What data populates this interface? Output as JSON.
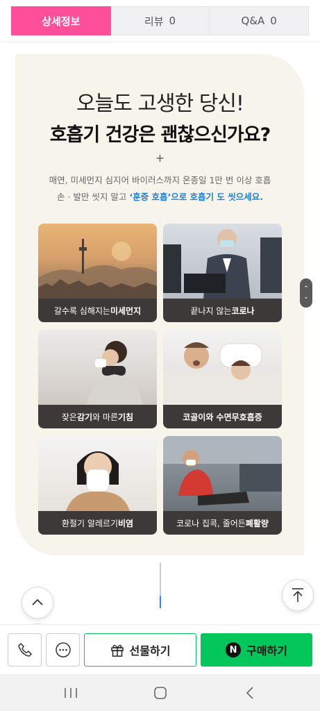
{
  "tabs": [
    {
      "label": "상세정보",
      "count": ""
    },
    {
      "label": "리뷰",
      "count": "0"
    },
    {
      "label": "Q&A",
      "count": "0"
    }
  ],
  "headline": {
    "line1": "오늘도 고생한 당신!",
    "line2": "호흡기 건강은 괜찮으신가요?",
    "plus": "+"
  },
  "description": {
    "line1": "매연, 미세먼지 심지어 바이러스까지 온종일 1만 번 이상 호흡",
    "line2_prefix": "손 · 발만 씻지 말고 ",
    "line2_highlight": "‘훈증 호흡’으로 호흡기 도 씻으세요."
  },
  "tiles": [
    {
      "normal": "갈수록 심해지는 ",
      "bold": "미세먼지",
      "suffix": ""
    },
    {
      "normal": "끝나지 않는 ",
      "bold": "코로나",
      "suffix": ""
    },
    {
      "normal": "잦은 ",
      "bold": "감기",
      "suffix": "와 마른 ",
      "bold2": "기침"
    },
    {
      "normal": "",
      "bold": "코골이와 수면무호흡증",
      "suffix": ""
    },
    {
      "normal": "환절기 알레르기 ",
      "bold": "비염",
      "suffix": ""
    },
    {
      "normal": "코로나 집콕, 줄어든 ",
      "bold": "폐활량",
      "suffix": ""
    }
  ],
  "buybar": {
    "gift_label": "선물하기",
    "buy_label": "구매하기",
    "n_badge": "N"
  },
  "icons": {
    "side_handle": "scroll-handle-icon",
    "up": "chevron-up-icon",
    "down": "chevron-down-icon",
    "top": "scroll-to-top-icon",
    "phone": "phone-icon",
    "chat": "chat-icon",
    "gift": "gift-icon",
    "recent": "recent-apps-icon",
    "home": "home-icon",
    "back": "back-icon"
  },
  "colors": {
    "active_tab": "#ff4f9a",
    "highlight": "#1f7fd6",
    "buy_green": "#03c75a"
  }
}
